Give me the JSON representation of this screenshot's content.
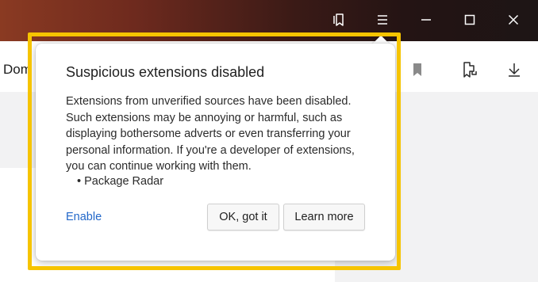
{
  "address": {
    "text": "Dom"
  },
  "popup": {
    "title": "Suspicious extensions disabled",
    "body": "Extensions from unverified sources have been disabled. Such extensions may be annoying or harmful, such as displaying bothersome adverts or even transferring your personal information. If you're a developer of extensions, you can continue working with them.",
    "list_items": [
      "• Package Radar"
    ],
    "enable_link": "Enable",
    "ok_button": "OK, got it",
    "learn_more_button": "Learn more"
  },
  "titlebar_icons": [
    "bookmarks-collection-icon",
    "menu-icon",
    "minimize-icon",
    "maximize-icon",
    "close-icon"
  ],
  "toolbar_icons": [
    "bookmark-icon",
    "extensions-icon",
    "download-icon"
  ],
  "colors": {
    "highlight": "#f6c400",
    "link": "#2267c9",
    "titlebar_left": "#8a3a22",
    "titlebar_right": "#1d1515"
  }
}
